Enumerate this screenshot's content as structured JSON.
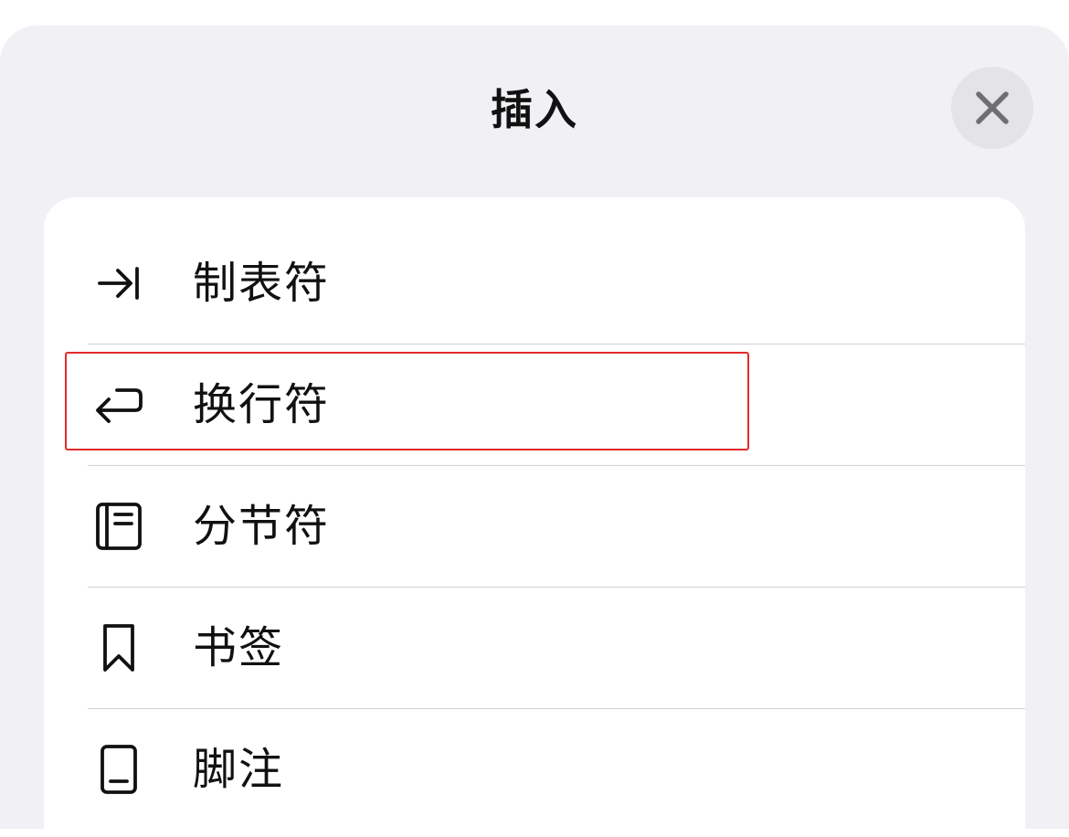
{
  "header": {
    "title": "插入",
    "close_icon": "close-icon"
  },
  "menu": {
    "items": [
      {
        "label": "制表符",
        "icon": "tab-arrow-icon"
      },
      {
        "label": "换行符",
        "icon": "line-break-return-icon"
      },
      {
        "label": "分节符",
        "icon": "section-break-icon"
      },
      {
        "label": "书签",
        "icon": "bookmark-icon"
      },
      {
        "label": "脚注",
        "icon": "footnote-icon"
      }
    ]
  },
  "annotation": {
    "highlight_color": "#e32b2b",
    "highlighted_item": "换行符"
  },
  "colors": {
    "sheet_background": "#f0f0f5",
    "list_background": "#ffffff",
    "text": "#111111"
  }
}
